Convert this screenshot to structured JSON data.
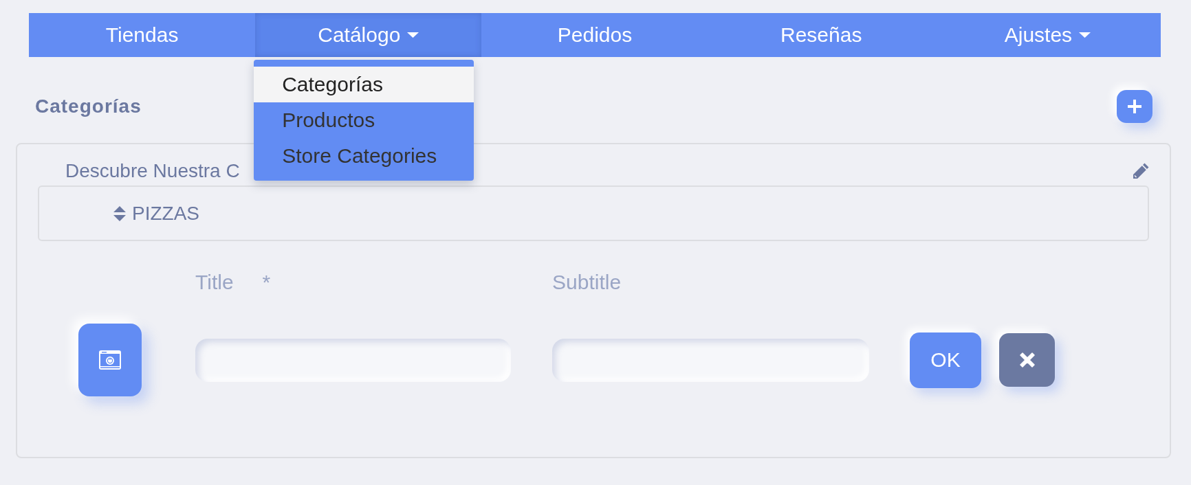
{
  "nav": {
    "items": [
      {
        "label": "Tiendas",
        "kind": "link",
        "selected": false
      },
      {
        "label": "Catálogo",
        "kind": "dropdown",
        "selected": true,
        "menu": [
          {
            "label": "Categorías",
            "selected": true
          },
          {
            "label": "Productos",
            "selected": false
          },
          {
            "label": "Store Categories",
            "selected": false
          }
        ]
      },
      {
        "label": "Pedidos",
        "kind": "link",
        "selected": false
      },
      {
        "label": "Reseñas",
        "kind": "link",
        "selected": false
      },
      {
        "label": "Ajustes",
        "kind": "dropdown",
        "selected": false
      }
    ]
  },
  "page": {
    "title": "Categorías"
  },
  "card": {
    "title": "Descubre Nuestra C",
    "categories": [
      {
        "name": "PIZZAS"
      }
    ],
    "form": {
      "fields": [
        {
          "label": "Title",
          "required_mark": "*"
        },
        {
          "label": "Subtitle"
        }
      ],
      "confirm_label": "OK"
    }
  }
}
